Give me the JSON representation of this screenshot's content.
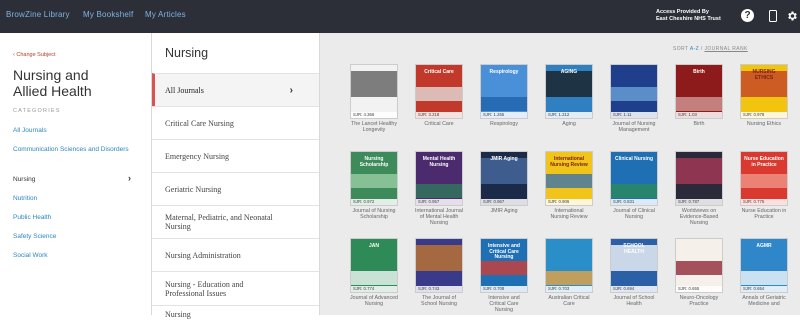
{
  "topbar": {
    "nav": [
      "BrowZine Library",
      "My Bookshelf",
      "My Articles"
    ],
    "access_line1": "Access Provided By",
    "access_line2": "East Cheshire NHS Trust",
    "help_glyph": "?",
    "icons": [
      "help-icon",
      "phone-icon",
      "gear-icon"
    ]
  },
  "sidebar": {
    "change_subject": "‹ Change Subject",
    "subject_line1": "Nursing and",
    "subject_line2": "Allied Health",
    "categories_label": "CATEGORIES",
    "categories": [
      {
        "label": "All Journals",
        "active": false
      },
      {
        "label": "Communication Sciences and Disorders",
        "active": false
      },
      {
        "label": "Nursing",
        "active": true
      },
      {
        "label": "Nutrition",
        "active": false
      },
      {
        "label": "Public Health",
        "active": false
      },
      {
        "label": "Safety Science",
        "active": false
      },
      {
        "label": "Social Work",
        "active": false
      }
    ]
  },
  "subcategories": {
    "title": "Nursing",
    "items": [
      {
        "label": "All Journals",
        "active": true
      },
      {
        "label": "Critical Care Nursing",
        "active": false
      },
      {
        "label": "Emergency Nursing",
        "active": false
      },
      {
        "label": "Geriatric Nursing",
        "active": false
      },
      {
        "label": "Maternal, Pediatric, and Neonatal Nursing",
        "active": false
      },
      {
        "label": "Nursing Administration",
        "active": false
      },
      {
        "label": "Nursing - Education and Professional Issues",
        "active": false
      },
      {
        "label": "Nursing",
        "active": false
      }
    ]
  },
  "sort": {
    "prefix": "SORT",
    "selected": "A-Z",
    "separator": "/",
    "alternative": "JOURNAL RANK"
  },
  "journals": [
    {
      "title": "The Lancet Healthy Longevity",
      "sjr": "SJR: 4.366",
      "cover_text": "",
      "color": "#f2f2f2",
      "accent": "#555555"
    },
    {
      "title": "Critical Care",
      "sjr": "SJR: 3.218",
      "cover_text": "Critical Care",
      "color": "#c0392b",
      "accent": "#e5e5e5"
    },
    {
      "title": "Respirology",
      "sjr": "SJR: 1.265",
      "cover_text": "Respirology",
      "color": "#4a90d9",
      "accent": "#1e5fa8"
    },
    {
      "title": "Aging",
      "sjr": "SJR: 1.212",
      "cover_text": "AGING",
      "color": "#2f7fc1",
      "accent": "#1a1a1a"
    },
    {
      "title": "Journal of Nursing Management",
      "sjr": "SJR: 1.11",
      "cover_text": "",
      "color": "#1f3f8c",
      "accent": "#6fa9dc"
    },
    {
      "title": "Birth",
      "sjr": "SJR: 1.03",
      "cover_text": "Birth",
      "color": "#8e1b1b",
      "accent": "#d4a0a0"
    },
    {
      "title": "Nursing Ethics",
      "sjr": "SJR: 0.978",
      "cover_text": "NURSING ETHICS",
      "color": "#f1c40f",
      "accent": "#c0392b"
    },
    {
      "title": "Journal of Nursing Scholarship",
      "sjr": "SJR: 0.972",
      "cover_text": "Nursing Scholarship",
      "color": "#3d8b5a",
      "accent": "#9fd1a9"
    },
    {
      "title": "International Journal of Mental Health Nursing",
      "sjr": "SJR: 0.957",
      "cover_text": "Mental Health Nursing",
      "color": "#4b2a6e",
      "accent": "#2e7d5a"
    },
    {
      "title": "JMIR Aging",
      "sjr": "SJR: 0.967",
      "cover_text": "JMIR Aging",
      "color": "#1c2a4a",
      "accent": "#4a6fa5"
    },
    {
      "title": "International Nursing Review",
      "sjr": "SJR: 0.906",
      "cover_text": "International Nursing Review",
      "color": "#f0c419",
      "accent": "#2f6fb5"
    },
    {
      "title": "Journal of Clinical Nursing",
      "sjr": "SJR: 0.831",
      "cover_text": "Clinical Nursing",
      "color": "#1f6fb5",
      "accent": "#2e8b57"
    },
    {
      "title": "Worldviews on Evidence-Based Nursing",
      "sjr": "SJR: 0.787",
      "cover_text": "",
      "color": "#2a2a3a",
      "accent": "#b03a5a"
    },
    {
      "title": "Nurse Education in Practice",
      "sjr": "SJR: 0.775",
      "cover_text": "Nurse Education in Practice",
      "color": "#d9392e",
      "accent": "#f29a8f"
    },
    {
      "title": "Journal of Advanced Nursing",
      "sjr": "SJR: 0.774",
      "cover_text": "JAN",
      "color": "#2e8b57",
      "accent": "#ffffff"
    },
    {
      "title": "The Journal of School Nursing",
      "sjr": "SJR: 0.743",
      "cover_text": "",
      "color": "#3a3a8a",
      "accent": "#c97a2a"
    },
    {
      "title": "Intensive and Critical Care Nursing",
      "sjr": "SJR: 0.708",
      "cover_text": "Intensive and Critical Care Nursing",
      "color": "#1f6fb5",
      "accent": "#d9392e"
    },
    {
      "title": "Australian Critical Care",
      "sjr": "SJR: 0.703",
      "cover_text": "",
      "color": "#2a8fc9",
      "accent": "#f3a33a"
    },
    {
      "title": "Journal of School Health",
      "sjr": "SJR: 0.694",
      "cover_text": "SCHOOL HEALTH",
      "color": "#2b5fa6",
      "accent": "#ffffff"
    },
    {
      "title": "Neuro-Oncology Practice",
      "sjr": "SJR: 0.655",
      "cover_text": "",
      "color": "#f5f0ea",
      "accent": "#8a1c2b"
    },
    {
      "title": "Annals of Geriatric Medicine and",
      "sjr": "SJR: 0.654",
      "cover_text": "AGMR",
      "color": "#2f86c8",
      "accent": "#ffffff"
    }
  ]
}
